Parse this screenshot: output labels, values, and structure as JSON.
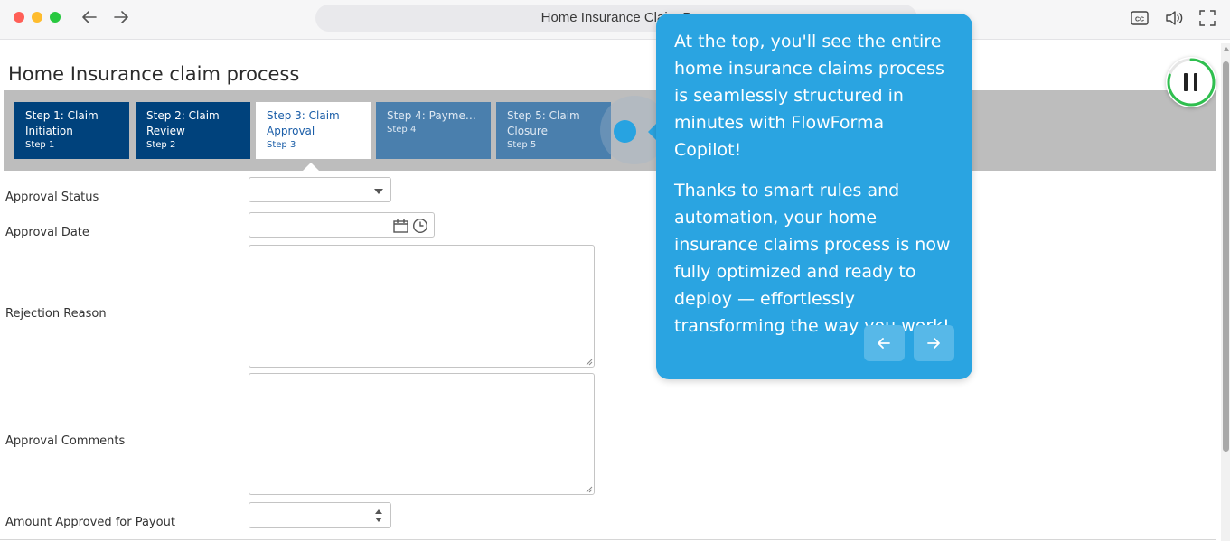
{
  "browser": {
    "url_title": "Home Insurance Claim P",
    "traffic_lights": [
      "close",
      "minimize",
      "maximize"
    ],
    "icons": [
      "back-arrow-icon",
      "forward-arrow-icon",
      "closed-captions-icon",
      "volume-icon",
      "fullscreen-icon"
    ]
  },
  "page": {
    "title": "Home Insurance claim process"
  },
  "steps": [
    {
      "name": "Step 1: Claim Initiation",
      "sub": "Step 1",
      "state": "done"
    },
    {
      "name": "Step 2: Claim Review",
      "sub": "Step 2",
      "state": "done"
    },
    {
      "name": "Step 3: Claim Approval",
      "sub": "Step 3",
      "state": "active"
    },
    {
      "name": "Step 4: Payment...",
      "sub": "Step 4",
      "state": "future"
    },
    {
      "name": "Step 5: Claim Closure",
      "sub": "Step 5",
      "state": "future"
    }
  ],
  "form": {
    "approval_status": {
      "label": "Approval Status",
      "value": ""
    },
    "approval_date": {
      "label": "Approval Date",
      "value": ""
    },
    "rejection_reason": {
      "label": "Rejection Reason",
      "value": ""
    },
    "approval_comments": {
      "label": "Approval Comments",
      "value": ""
    },
    "amount_approved": {
      "label": "Amount Approved for Payout",
      "value": ""
    }
  },
  "tooltip": {
    "paragraph_1": "At the top, you'll see the entire home insurance claims process is seamlessly structured in minutes with FlowForma Copilot!",
    "paragraph_2": "Thanks to smart rules and automation, your home insurance claims process is now fully optimized and ready to deploy — effortlessly transforming the way you work!"
  },
  "colors": {
    "step_done": "#00427c",
    "step_future": "#4a7fad",
    "tooltip_bg": "#2aa4e1",
    "pause_ring": "#2fbf4f"
  },
  "player": {
    "progress": 0.8
  }
}
